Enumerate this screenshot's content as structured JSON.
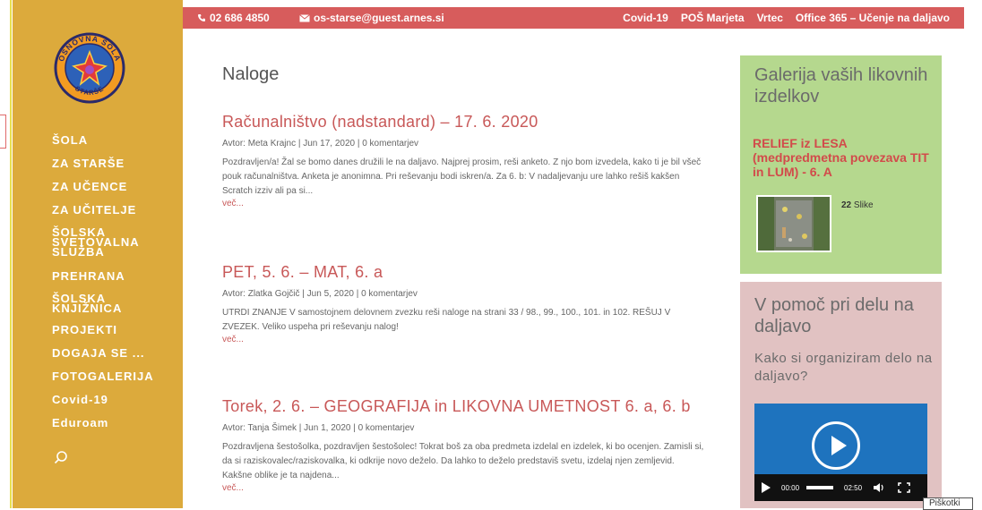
{
  "topbar": {
    "phone": "02 686 4850",
    "email": "os-starse@guest.arnes.si",
    "links": [
      "Covid-19",
      "POŠ Marjeta",
      "Vrtec",
      "Office 365 – Učenje na daljavo"
    ]
  },
  "logo": {
    "text_top": "OSNOVNA ŠOLA",
    "text_bottom": "STARŠE"
  },
  "sidebar": {
    "items": [
      "ŠOLA",
      "ZA STARŠE",
      "ZA UČENCE",
      "ZA UČITELJE",
      "ŠOLSKA SVETOVALNA SLUŽBA",
      "PREHRANA",
      "ŠOLSKA KNJIŽNICA",
      "PROJEKTI",
      "DOGAJA SE ...",
      "FOTOGALERIJA",
      "Covid-19",
      "Eduroam"
    ]
  },
  "main": {
    "title": "Naloge",
    "posts": [
      {
        "title": "Računalništvo (nadstandard) – 17. 6. 2020",
        "meta_prefix": "Avtor:",
        "author": "Meta Krajnc",
        "date": "Jun 17, 2020",
        "comments": "0 komentarjev",
        "excerpt": "Pozdravljen/a! Žal se bomo danes družili le na daljavo. Najprej prosim, reši anketo. Z njo bom izvedela, kako ti je bil všeč pouk računalništva. Anketa je anonimna. Pri reševanju bodi iskren/a. Za 6. b: V nadaljevanju ure lahko rešiš kakšen Scratch izziv ali pa si...",
        "more": "več..."
      },
      {
        "title": "PET, 5. 6. – MAT, 6. a",
        "meta_prefix": "Avtor:",
        "author": "Zlatka Gojčič",
        "date": "Jun 5, 2020",
        "comments": "0 komentarjev",
        "excerpt": "UTRDI ZNANJE V samostojnem delovnem zvezku reši naloge na strani 33 / 98., 99., 100., 101. in 102. REŠUJ V ZVEZEK. Veliko uspeha pri reševanju nalog!",
        "more": "več..."
      },
      {
        "title": "Torek, 2. 6. – GEOGRAFIJA in LIKOVNA UMETNOST 6. a, 6. b",
        "meta_prefix": "Avtor:",
        "author": "Tanja Šimek",
        "date": "Jun 1, 2020",
        "comments": "0 komentarjev",
        "excerpt": "Pozdravljena šestošolka, pozdravljen šestošolec! Tokrat boš za oba predmeta izdelal en izdelek, ki bo ocenjen. Zamisli si, da si raziskovalec/raziskovalka, ki odkrije novo deželo. Da lahko to deželo predstaviš svetu, izdelaj njen zemljevid. Kakšne oblike je ta najdena...",
        "more": "več..."
      }
    ]
  },
  "widget_gallery": {
    "title": "Galerija vaših likovnih izdelkov",
    "gallery_title": "RELIEF iz LESA (medpredmetna povezava TIT in LUM) - 6. A",
    "count_number": "22",
    "count_label": "Slike"
  },
  "widget_help": {
    "title": "V pomoč pri delu na daljavo",
    "subtitle": "Kako si organiziram delo na daljavo?",
    "video": {
      "current_time": "00:00",
      "duration": "02:50"
    }
  },
  "cookie_label": "Piškotki",
  "colors": {
    "sidebar": "#dcaa3c",
    "topbar": "#d75c5c",
    "accent": "#c85858",
    "widget_green": "#b5d88e",
    "widget_pink": "#e1c2c2",
    "video_blue": "#1e73be"
  }
}
